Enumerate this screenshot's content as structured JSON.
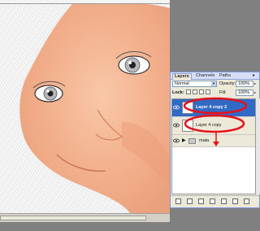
{
  "layers_panel": {
    "tabs": [
      "Layers",
      "Channels",
      "Paths"
    ],
    "menu_icon": "panel-menu-icon",
    "blend_mode": "Normal",
    "opacity_label": "Opacity:",
    "opacity_value": "100%",
    "lock_label": "Lock:",
    "fill_label": "Fill:",
    "fill_value": "100%",
    "layers": [
      {
        "name": "Layer 4 copy 2",
        "selected": true
      },
      {
        "name": "Layer 4 copy",
        "selected": false
      },
      {
        "name": "mata",
        "selected": false,
        "group": true
      }
    ],
    "bottom_icons": [
      "link-icon",
      "fx-icon",
      "mask-icon",
      "adjustment-icon",
      "folder-icon",
      "new-layer-icon",
      "trash-icon"
    ]
  },
  "annotations": {
    "highlight_color": "#e8101a",
    "selection_color": "#316ac5"
  }
}
